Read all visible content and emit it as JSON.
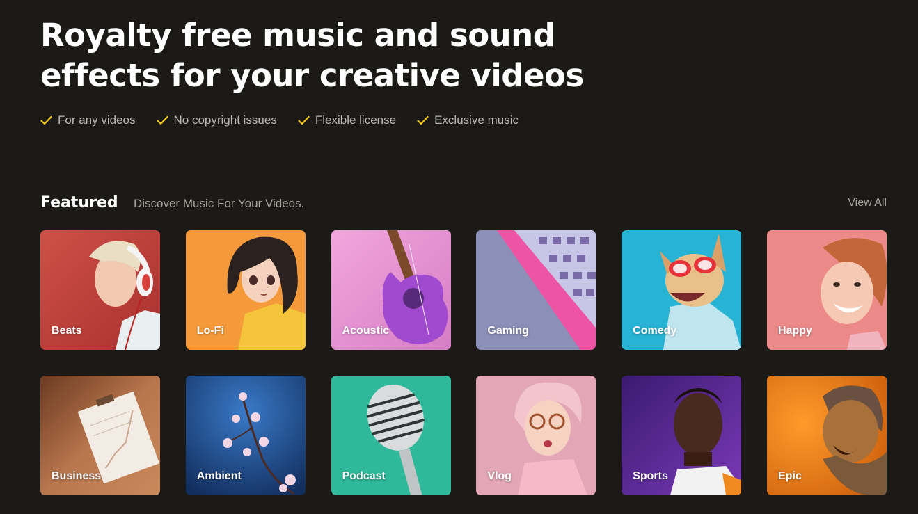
{
  "hero": {
    "title_line1": "Royalty free music and sound",
    "title_line2": "effects for your creative videos"
  },
  "features": [
    {
      "label": "For any videos",
      "icon": "check-icon"
    },
    {
      "label": "No copyright issues",
      "icon": "check-icon"
    },
    {
      "label": "Flexible license",
      "icon": "check-icon"
    },
    {
      "label": "Exclusive music",
      "icon": "check-icon"
    }
  ],
  "featured": {
    "title": "Featured",
    "subtitle": "Discover Music For Your Videos.",
    "view_all": "View All",
    "categories": [
      {
        "label": "Beats",
        "bg": "#c4423f"
      },
      {
        "label": "Lo-Fi",
        "bg": "#f49a3a"
      },
      {
        "label": "Acoustic",
        "bg": "#e98fd2"
      },
      {
        "label": "Gaming",
        "bg": "#8c8fb8"
      },
      {
        "label": "Comedy",
        "bg": "#27b3d3"
      },
      {
        "label": "Happy",
        "bg": "#ec8a8a"
      },
      {
        "label": "Business",
        "bg": "#a86845"
      },
      {
        "label": "Ambient",
        "bg": "#1c4c85"
      },
      {
        "label": "Podcast",
        "bg": "#2fb89a"
      },
      {
        "label": "Vlog",
        "bg": "#e2a6b7"
      },
      {
        "label": "Sports",
        "bg": "#5a2a8e"
      },
      {
        "label": "Epic",
        "bg": "#ec7414"
      }
    ]
  },
  "colors": {
    "background": "#1b1a16",
    "accent_check": "#f5c518",
    "muted_text": "#a6a59f"
  }
}
